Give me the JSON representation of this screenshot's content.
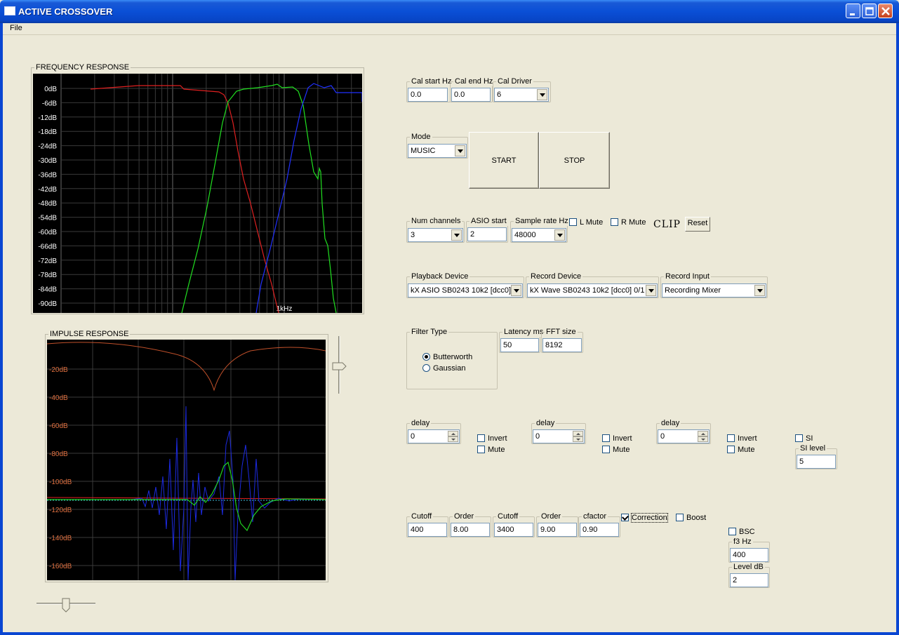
{
  "window": {
    "title": "ACTIVE CROSSOVER",
    "accent_color": "#0a46d2"
  },
  "menu": {
    "file": "File"
  },
  "freq": {
    "title": "FREQUENCY RESPONSE",
    "y_labels": [
      "0dB",
      "-6dB",
      "-12dB",
      "-18dB",
      "-24dB",
      "-30dB",
      "-36dB",
      "-42dB",
      "-48dB",
      "-54dB",
      "-60dB",
      "-66dB",
      "-72dB",
      "-78dB",
      "-84dB",
      "-90dB"
    ],
    "x_label": "1kHz"
  },
  "impulse": {
    "title": "IMPULSE RESPONSE",
    "y_labels": [
      "-20dB",
      "-40dB",
      "-60dB",
      "-80dB",
      "-100dB",
      "-120dB",
      "-140dB",
      "-160dB"
    ],
    "label_color": "#e07040"
  },
  "cal": {
    "start_label": "Cal start Hz",
    "start_value": "0.0",
    "end_label": "Cal end Hz",
    "end_value": "0.0",
    "driver_label": "Cal Driver",
    "driver_value": "6"
  },
  "mode": {
    "label": "Mode",
    "value": "MUSIC",
    "start": "START",
    "stop": "STOP"
  },
  "channels": {
    "num_label": "Num channels",
    "num_value": "3",
    "asio_label": "ASIO start",
    "asio_value": "2",
    "rate_label": "Sample rate Hz",
    "rate_value": "48000",
    "lmute": "L Mute",
    "rmute": "R Mute",
    "clip": "CLIP",
    "reset": "Reset"
  },
  "devices": {
    "playback_label": "Playback Device",
    "playback_value": "kX ASIO SB0243 10k2 [dcc0]",
    "record_label": "Record Device",
    "record_value": "kX Wave SB0243 10k2 [dcc0] 0/1",
    "input_label": "Record Input",
    "input_value": "Recording Mixer"
  },
  "filter": {
    "label": "Filter Type",
    "butterworth": "Butterworth",
    "gaussian": "Gaussian",
    "selected": "Butterworth",
    "latency_label": "Latency ms",
    "latency_value": "50",
    "fft_label": "FFT size",
    "fft_value": "8192"
  },
  "channel_strips": [
    {
      "delay_label": "delay",
      "delay_value": "0",
      "invert": "Invert",
      "mute": "Mute"
    },
    {
      "delay_label": "delay",
      "delay_value": "0",
      "invert": "Invert",
      "mute": "Mute"
    },
    {
      "delay_label": "delay",
      "delay_value": "0",
      "invert": "Invert",
      "mute": "Mute"
    }
  ],
  "si": {
    "label": "SI",
    "level_label": "SI level",
    "level_value": "5"
  },
  "crossover": {
    "cutoff1_label": "Cutoff",
    "cutoff1_value": "400",
    "order1_label": "Order",
    "order1_value": "8.00",
    "cutoff2_label": "Cutoff",
    "cutoff2_value": "3400",
    "order2_label": "Order",
    "order2_value": "9.00",
    "cfactor_label": "cfactor",
    "cfactor_value": "0.90",
    "correction": "Correction",
    "boost": "Boost"
  },
  "bsc": {
    "label": "BSC",
    "f3_label": "f3 Hz",
    "f3_value": "400",
    "level_label": "Level dB",
    "level_value": "2"
  }
}
